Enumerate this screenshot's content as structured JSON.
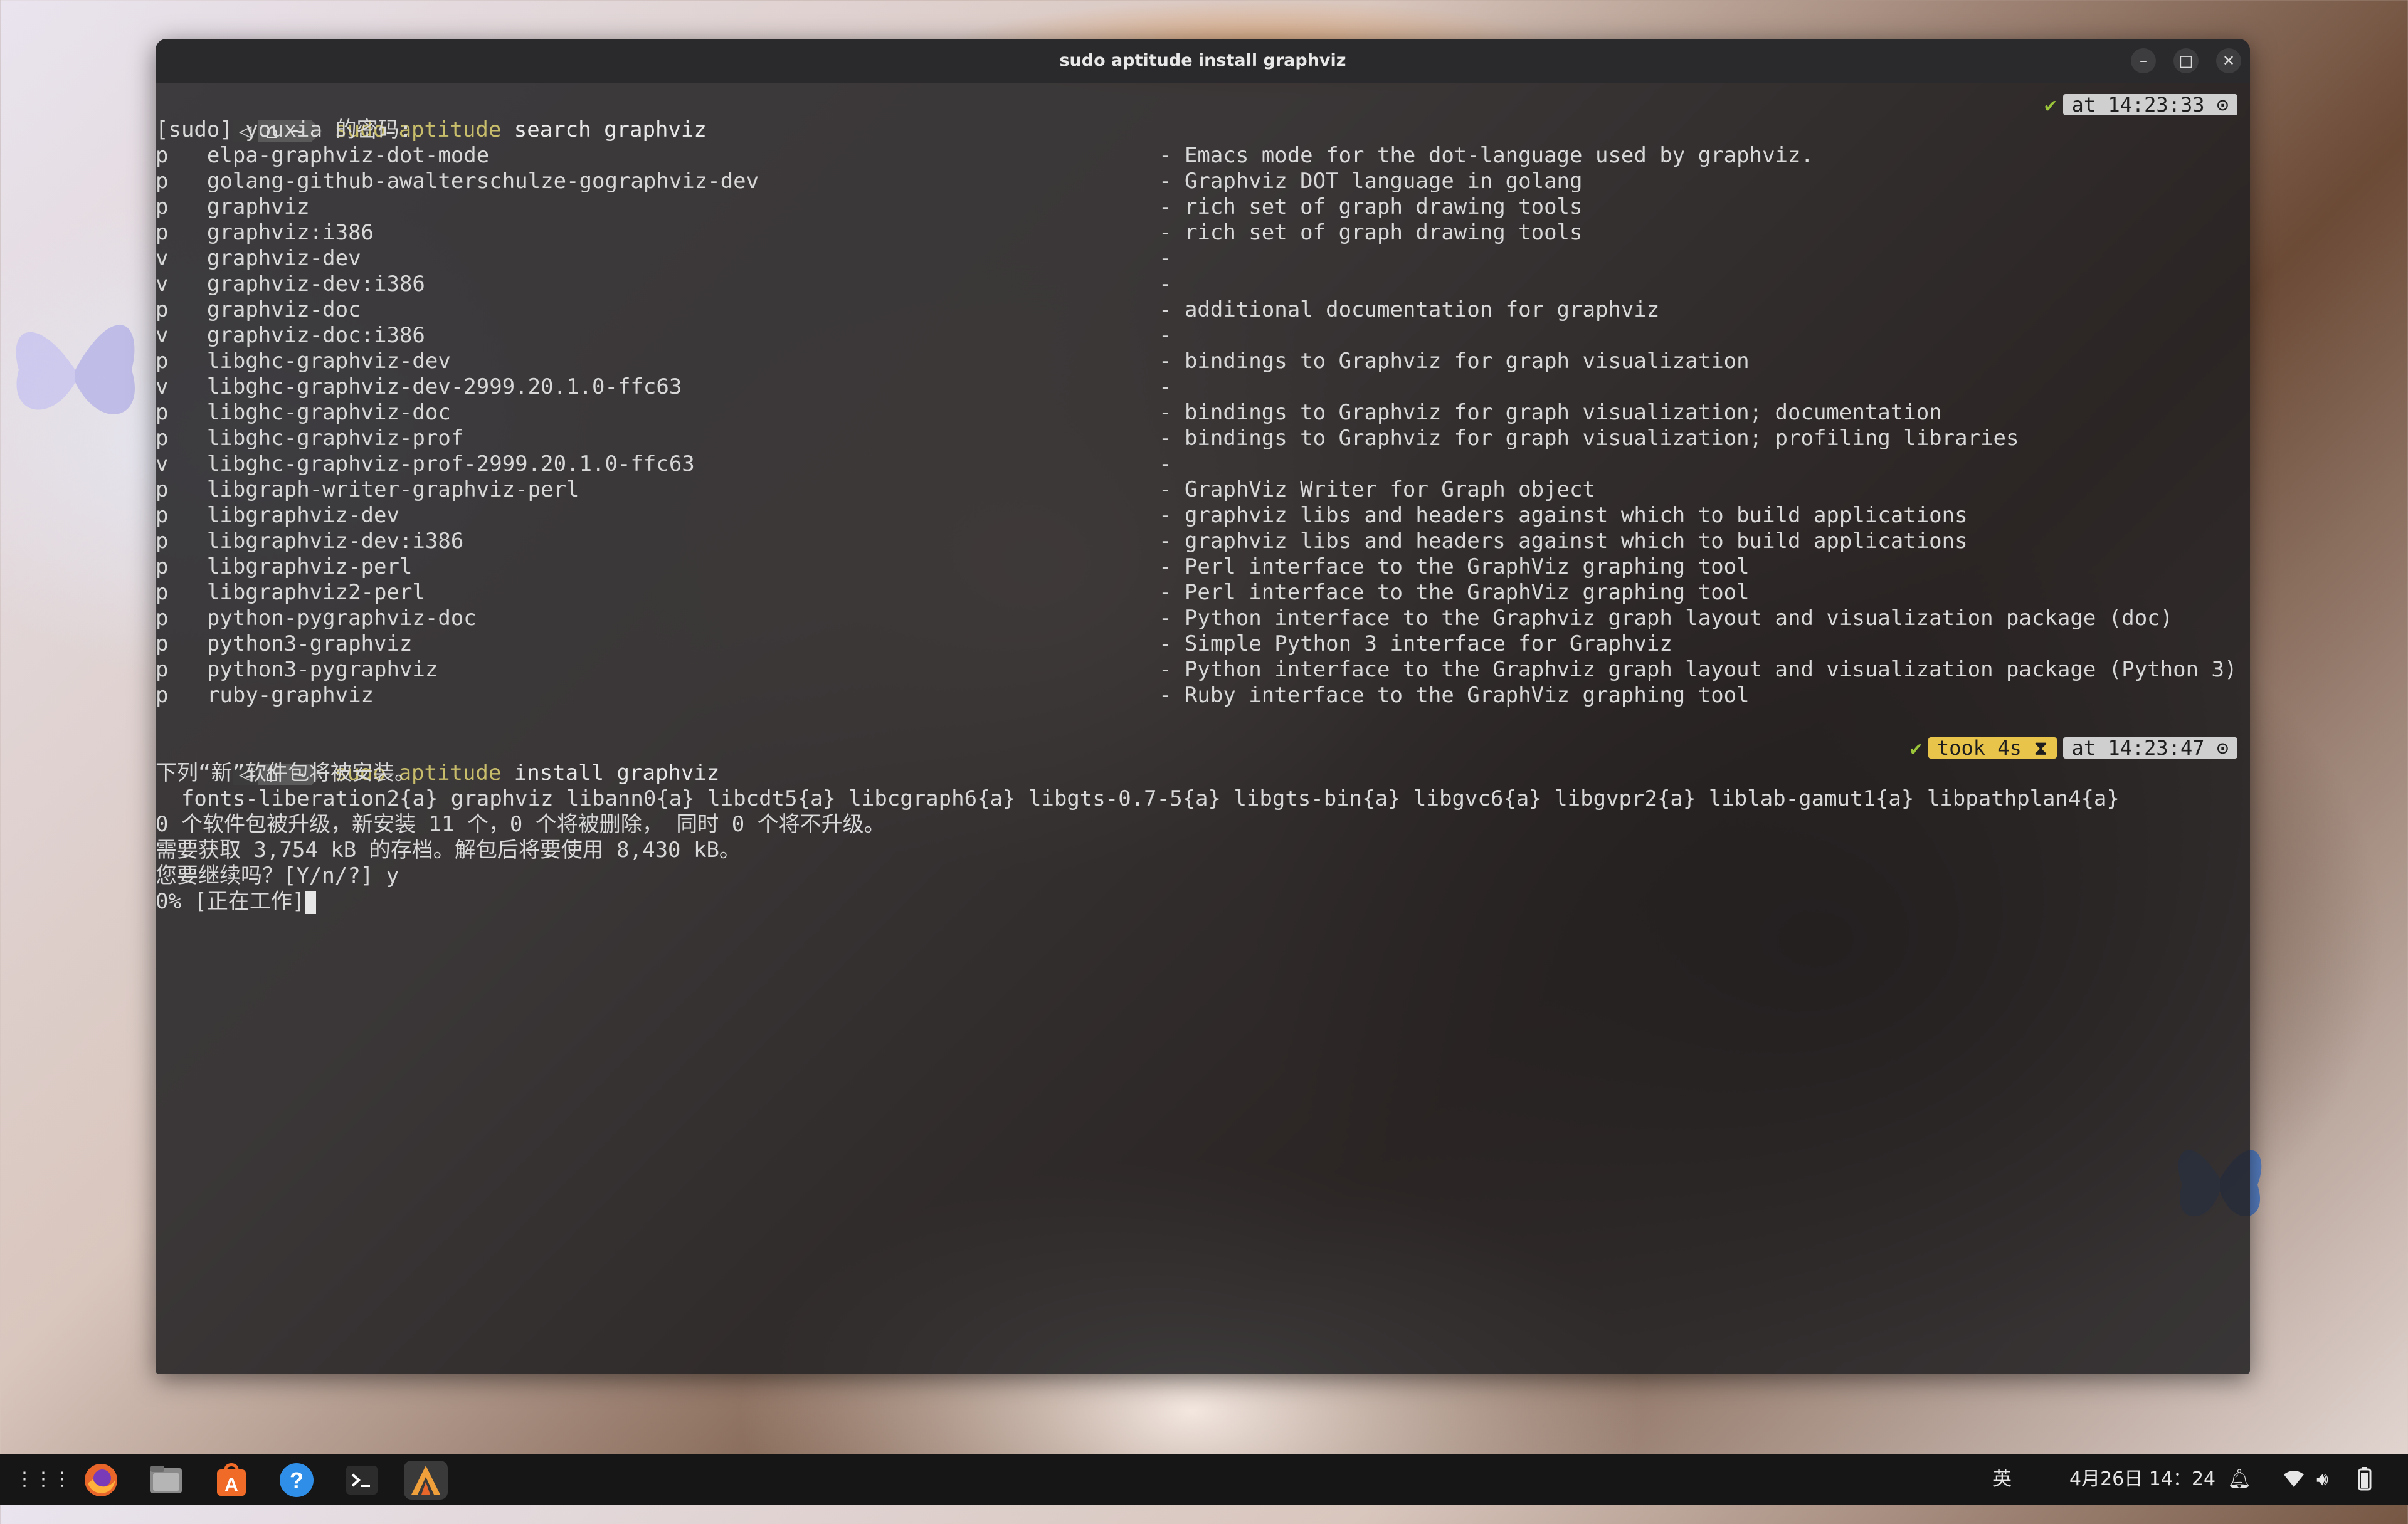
{
  "window": {
    "title": "sudo aptitude install graphviz",
    "controls": [
      "minimize-icon",
      "maximize-icon",
      "close-icon"
    ]
  },
  "prompt": {
    "seg1": "◁",
    "seg2": "⌂ ~",
    "sudo": "sudo aptitude",
    "cmd1": " search graphviz",
    "cmd2": " install graphviz",
    "right1": {
      "check": "✔",
      "at": "at 14:23:33 ⊙"
    },
    "right2": {
      "check": "✔",
      "took": "took 4s ⧗",
      "at": "at 14:23:47 ⊙"
    }
  },
  "sudo_line": "[sudo] youxia 的密码:",
  "search_results": [
    {
      "flag": "p",
      "pkg": "elpa-graphviz-dot-mode",
      "desc": "- Emacs mode for the dot-language used by graphviz."
    },
    {
      "flag": "p",
      "pkg": "golang-github-awalterschulze-gographviz-dev",
      "desc": "- Graphviz DOT language in golang"
    },
    {
      "flag": "p",
      "pkg": "graphviz",
      "desc": "- rich set of graph drawing tools"
    },
    {
      "flag": "p",
      "pkg": "graphviz:i386",
      "desc": "- rich set of graph drawing tools"
    },
    {
      "flag": "v",
      "pkg": "graphviz-dev",
      "desc": "-"
    },
    {
      "flag": "v",
      "pkg": "graphviz-dev:i386",
      "desc": "-"
    },
    {
      "flag": "p",
      "pkg": "graphviz-doc",
      "desc": "- additional documentation for graphviz"
    },
    {
      "flag": "v",
      "pkg": "graphviz-doc:i386",
      "desc": "-"
    },
    {
      "flag": "p",
      "pkg": "libghc-graphviz-dev",
      "desc": "- bindings to Graphviz for graph visualization"
    },
    {
      "flag": "v",
      "pkg": "libghc-graphviz-dev-2999.20.1.0-ffc63",
      "desc": "-"
    },
    {
      "flag": "p",
      "pkg": "libghc-graphviz-doc",
      "desc": "- bindings to Graphviz for graph visualization; documentation"
    },
    {
      "flag": "p",
      "pkg": "libghc-graphviz-prof",
      "desc": "- bindings to Graphviz for graph visualization; profiling libraries"
    },
    {
      "flag": "v",
      "pkg": "libghc-graphviz-prof-2999.20.1.0-ffc63",
      "desc": "-"
    },
    {
      "flag": "p",
      "pkg": "libgraph-writer-graphviz-perl",
      "desc": "- GraphViz Writer for Graph object"
    },
    {
      "flag": "p",
      "pkg": "libgraphviz-dev",
      "desc": "- graphviz libs and headers against which to build applications"
    },
    {
      "flag": "p",
      "pkg": "libgraphviz-dev:i386",
      "desc": "- graphviz libs and headers against which to build applications"
    },
    {
      "flag": "p",
      "pkg": "libgraphviz-perl",
      "desc": "- Perl interface to the GraphViz graphing tool"
    },
    {
      "flag": "p",
      "pkg": "libgraphviz2-perl",
      "desc": "- Perl interface to the GraphViz graphing tool"
    },
    {
      "flag": "p",
      "pkg": "python-pygraphviz-doc",
      "desc": "- Python interface to the Graphviz graph layout and visualization package (doc)"
    },
    {
      "flag": "p",
      "pkg": "python3-graphviz",
      "desc": "- Simple Python 3 interface for Graphviz"
    },
    {
      "flag": "p",
      "pkg": "python3-pygraphviz",
      "desc": "- Python interface to the Graphviz graph layout and visualization package (Python 3)"
    },
    {
      "flag": "p",
      "pkg": "ruby-graphviz",
      "desc": "- Ruby interface to the GraphViz graphing tool"
    }
  ],
  "install_output": [
    "下列“新”软件包将被安装。",
    "  fonts-liberation2{a} graphviz libann0{a} libcdt5{a} libcgraph6{a} libgts-0.7-5{a} libgts-bin{a} libgvc6{a} libgvpr2{a} liblab-gamut1{a} libpathplan4{a}",
    "0 个软件包被升级，新安装 11 个，0 个将被删除， 同时 0 个将不升级。",
    "需要获取 3,754 kB 的存档。解包后将要使用 8,430 kB。",
    "您要继续吗？[Y/n/?] y",
    "0% [正在工作]"
  ],
  "taskbar": {
    "apps": [
      {
        "name": "app-grid",
        "glyph": "⋮⋮⋮"
      },
      {
        "name": "firefox",
        "glyph": "●"
      },
      {
        "name": "files",
        "glyph": "▭"
      },
      {
        "name": "app-center",
        "glyph": "A"
      },
      {
        "name": "help",
        "glyph": "?"
      },
      {
        "name": "terminal",
        "glyph": ">_"
      },
      {
        "name": "alacritty",
        "glyph": "Λ"
      }
    ],
    "ime": "英",
    "datetime": "4月26日 14：24",
    "colors": {
      "firefox": "#e8662a",
      "files": "#8a8a8a",
      "app_center": "#f06a28",
      "help": "#2f8fe8",
      "alacritty": "#f0a03a"
    }
  }
}
